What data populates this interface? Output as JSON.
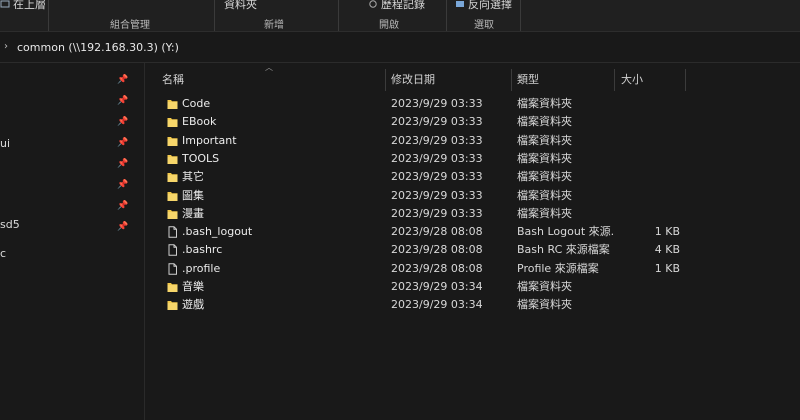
{
  "ribbon": {
    "top_items": [
      {
        "label": "在上層",
        "icon": "pin-icon"
      },
      {
        "label": "資料夾",
        "icon": "folder-icon"
      },
      {
        "label": "歷程記錄",
        "icon": "history-icon"
      },
      {
        "label": "反向選擇",
        "icon": "invert-selection-icon"
      }
    ],
    "groups": [
      "組合管理",
      "新增",
      "開啟",
      "選取"
    ]
  },
  "address": {
    "path": "common (\\\\192.168.30.3) (Y:)"
  },
  "nav": {
    "fragments": [
      "ui",
      "sd5",
      "c"
    ]
  },
  "columns": {
    "name": "名稱",
    "date": "修改日期",
    "type": "類型",
    "size": "大小"
  },
  "files": [
    {
      "name": "Code",
      "date": "2023/9/29 03:33",
      "type": "檔案資料夾",
      "size": "",
      "icon": "folder-icon"
    },
    {
      "name": "EBook",
      "date": "2023/9/29 03:33",
      "type": "檔案資料夾",
      "size": "",
      "icon": "folder-icon"
    },
    {
      "name": "Important",
      "date": "2023/9/29 03:33",
      "type": "檔案資料夾",
      "size": "",
      "icon": "folder-icon"
    },
    {
      "name": "TOOLS",
      "date": "2023/9/29 03:33",
      "type": "檔案資料夾",
      "size": "",
      "icon": "folder-icon"
    },
    {
      "name": "其它",
      "date": "2023/9/29 03:33",
      "type": "檔案資料夾",
      "size": "",
      "icon": "folder-icon"
    },
    {
      "name": "圖集",
      "date": "2023/9/29 03:33",
      "type": "檔案資料夾",
      "size": "",
      "icon": "folder-icon"
    },
    {
      "name": "漫畫",
      "date": "2023/9/29 03:33",
      "type": "檔案資料夾",
      "size": "",
      "icon": "folder-icon"
    },
    {
      "name": ".bash_logout",
      "date": "2023/9/28 08:08",
      "type": "Bash Logout 來源...",
      "size": "1 KB",
      "icon": "file-icon"
    },
    {
      "name": ".bashrc",
      "date": "2023/9/28 08:08",
      "type": "Bash RC 來源檔案",
      "size": "4 KB",
      "icon": "file-icon"
    },
    {
      "name": ".profile",
      "date": "2023/9/28 08:08",
      "type": "Profile 來源檔案",
      "size": "1 KB",
      "icon": "file-icon"
    },
    {
      "name": "音樂",
      "date": "2023/9/29 03:34",
      "type": "檔案資料夾",
      "size": "",
      "icon": "folder-icon"
    },
    {
      "name": "遊戲",
      "date": "2023/9/29 03:34",
      "type": "檔案資料夾",
      "size": "",
      "icon": "folder-icon"
    }
  ],
  "colors": {
    "background": "#191919",
    "ribbon": "#202020",
    "folder": "#f2c94c",
    "text": "#e0e0e0"
  }
}
